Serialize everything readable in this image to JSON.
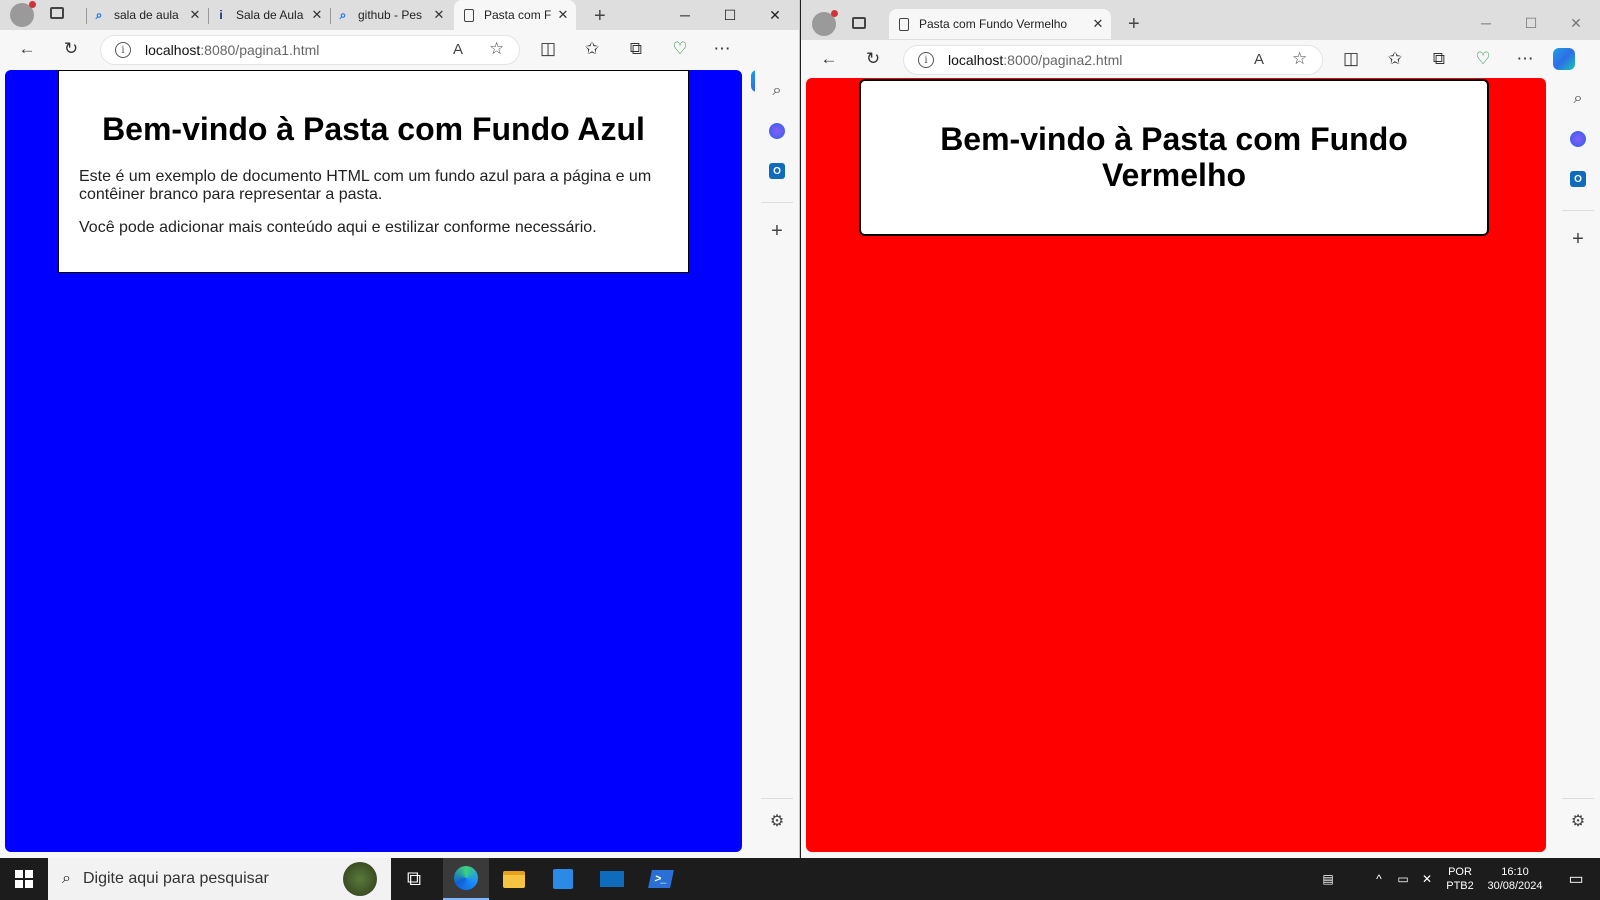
{
  "left_window": {
    "tabs": [
      {
        "label": "sala de aula",
        "icon": "search-icon"
      },
      {
        "label": "Sala de Aula",
        "icon": "info-icon"
      },
      {
        "label": "github - Pes",
        "icon": "search-icon"
      },
      {
        "label": "Pasta com F",
        "icon": "page-icon"
      }
    ],
    "url_host": "localhost",
    "url_rest": ":8080/pagina1.html",
    "page": {
      "bg_color": "#0000ff",
      "heading": "Bem-vindo à Pasta com Fundo Azul",
      "paragraph1": "Este é um exemplo de documento HTML com um fundo azul para a página e um contêiner branco para representar a pasta.",
      "paragraph2": "Você pode adicionar mais conteúdo aqui e estilizar conforme necessário."
    }
  },
  "right_window": {
    "tabs": [
      {
        "label": "Pasta com Fundo Vermelho",
        "icon": "page-icon"
      }
    ],
    "url_host": "localhost",
    "url_rest": ":8000/pagina2.html",
    "page": {
      "bg_color": "#ff0000",
      "heading": "Bem-vindo à Pasta com Fundo Vermelho"
    }
  },
  "taskbar": {
    "search_placeholder": "Digite aqui para pesquisar",
    "lang_line1": "POR",
    "lang_line2": "PTB2",
    "time": "16:10",
    "date": "30/08/2024"
  },
  "glyphs": {
    "close": "✕",
    "plus": "+",
    "minimize": "─",
    "maximize": "☐",
    "back": "←",
    "refresh": "↻",
    "info": "i",
    "read_aloud": "A",
    "star": "☆",
    "split": "◫",
    "favorites": "✩",
    "collections": "⧉",
    "more": "⋯",
    "search": "⌕",
    "add": "+",
    "settings": "⚙",
    "outlook": "O",
    "task_view": "⧉",
    "notifications": "▭",
    "chevron_up": "^",
    "network": "▭",
    "volume": "🔈",
    "keyboard": "⌨",
    "powershell": ">_"
  },
  "colors": {
    "left_page_bg": "#0000ff",
    "right_page_bg": "#ff0000",
    "taskbar_bg": "#1c1c1c"
  }
}
